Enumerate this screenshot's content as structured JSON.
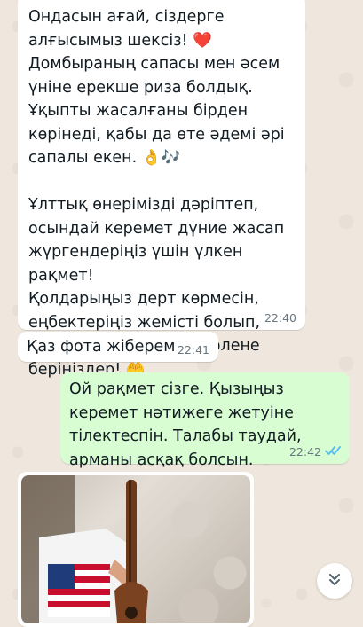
{
  "messages": [
    {
      "direction": "incoming",
      "text": "Ондасын ағай, сіздерге\nалғысымыз шексіз! ❤️\nДомбыраның сапасы мен әсем\nүніне ерекше риза болдық.\nҰқыпты жасалғаны бірден\nкөрінеді, қабы да өте әдемі әрі\nсапалы екен. 👌🎶\n\nҰлттық өнерімізді дәріптеп,\nосындай керемет дүние жасап\nжүргендеріңіз үшін үлкен рақмет!\nҚолдарыңыз дерт көрмесін,\nеңбектеріңіз жемісті болып,\nхалықтың алғысына бөлене\nберіңіздер! 🤲",
      "time": "22:40"
    },
    {
      "direction": "incoming",
      "text": "Қаз фота жіберем",
      "time": "22:41"
    },
    {
      "direction": "outgoing",
      "text": "Ой рақмет сізге. Қызыңыз\nкеремет нәтижеге жетуіне\nтілектеспін. Талабы таудай,\nарманы асқақ болсын.",
      "time": "22:42",
      "status_icon": "double-check-read-icon"
    },
    {
      "direction": "incoming",
      "type": "photo"
    }
  ],
  "colors": {
    "chat_background": "#efe7dd",
    "incoming_bubble": "#ffffff",
    "outgoing_bubble": "#d9fdd3",
    "read_tick": "#53bdeb",
    "meta_text": "#667781"
  },
  "controls": {
    "scroll_button_icon": "chevrons-down-icon"
  }
}
